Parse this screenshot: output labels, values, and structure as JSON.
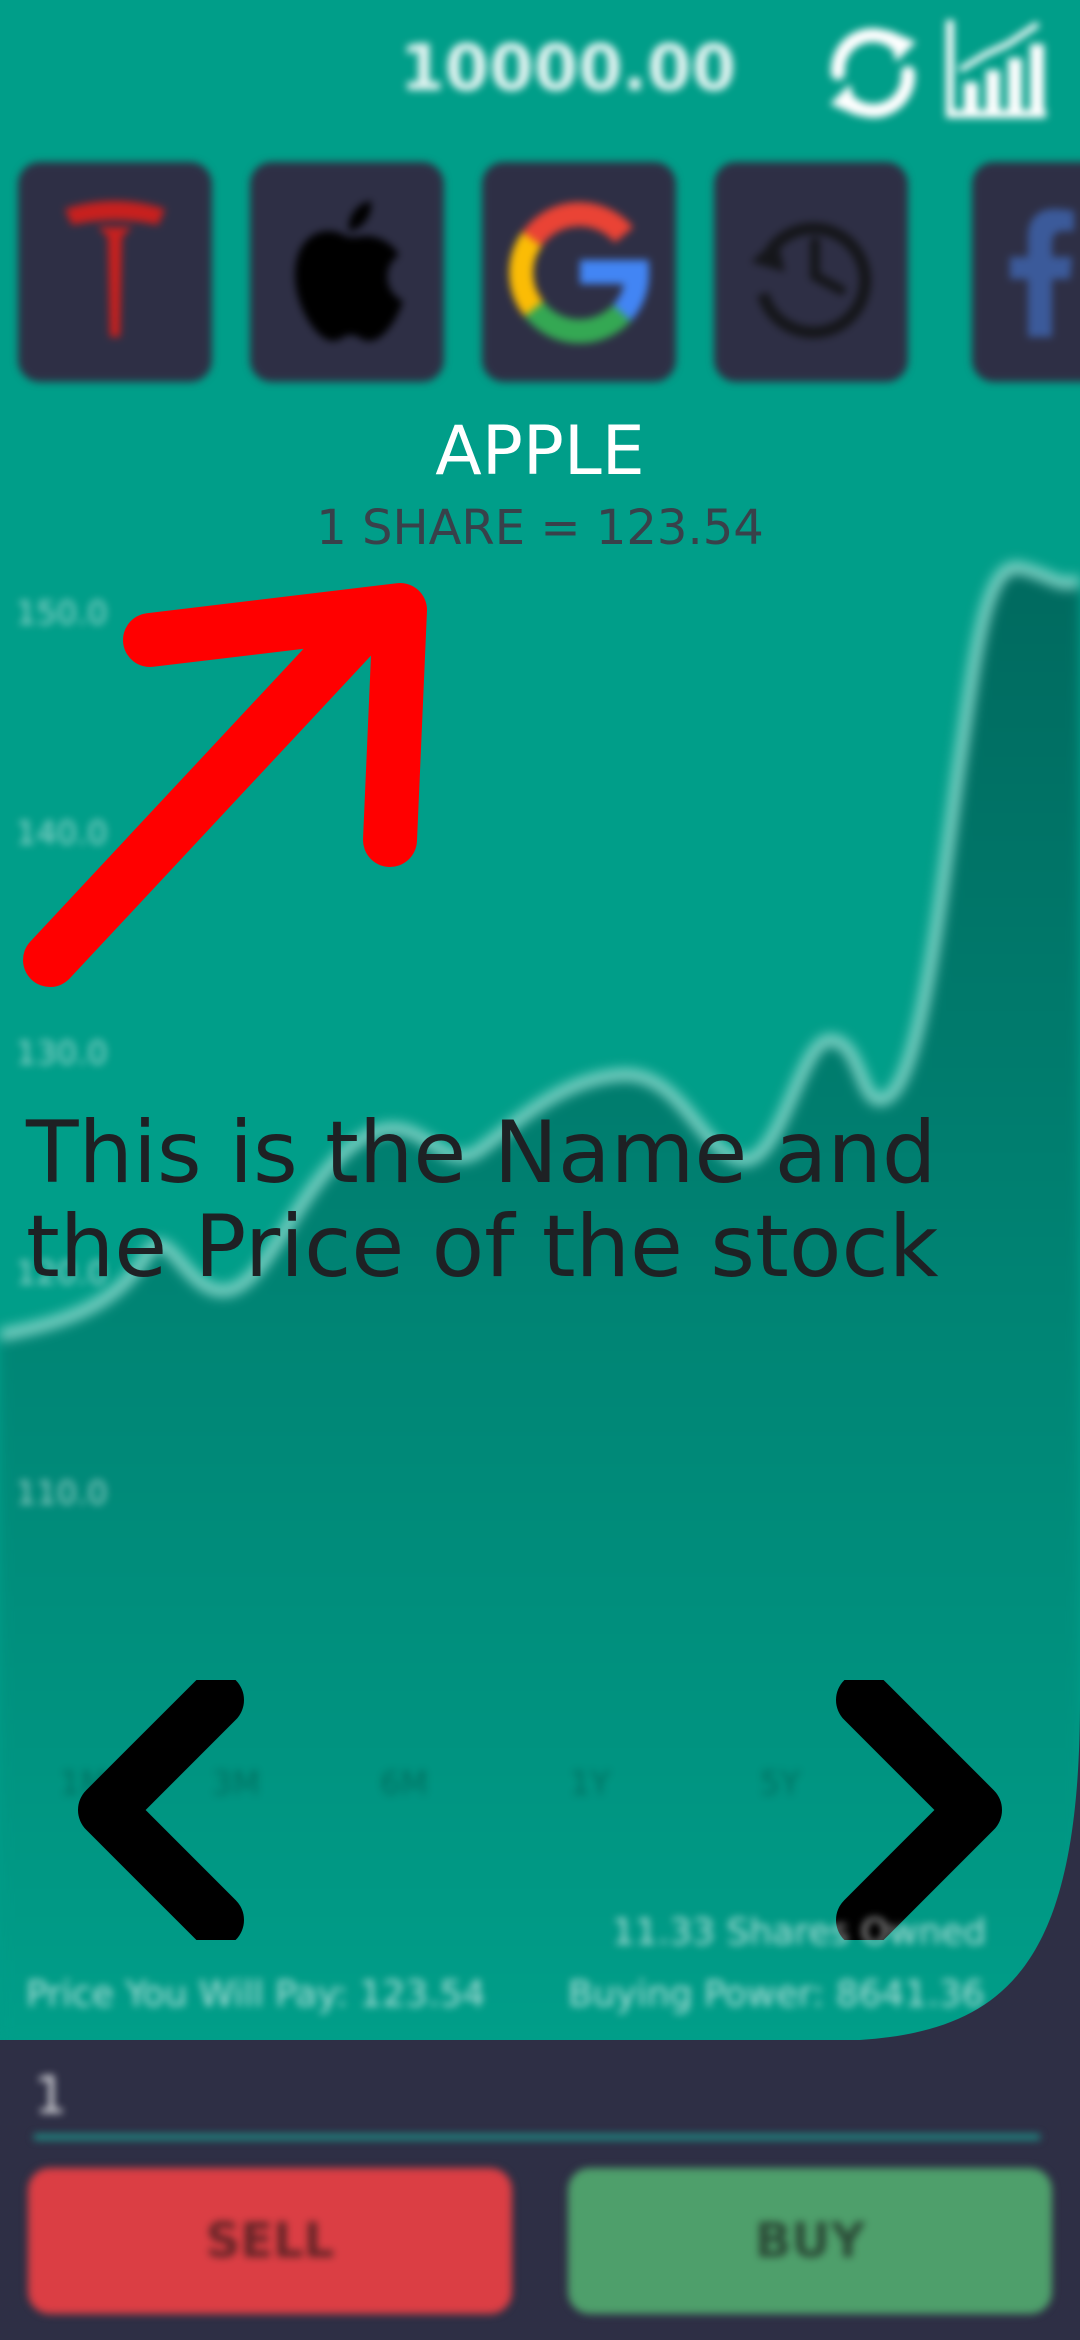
{
  "header": {
    "balance": "10000.00",
    "icons": [
      "refresh-icon",
      "stats-chart-icon"
    ]
  },
  "stocks": [
    {
      "name": "Tesla",
      "icon": "tesla-logo-icon"
    },
    {
      "name": "Apple",
      "icon": "apple-logo-icon"
    },
    {
      "name": "Google",
      "icon": "google-logo-icon"
    },
    {
      "name": "History",
      "icon": "history-icon"
    },
    {
      "name": "Facebook",
      "icon": "facebook-logo-icon"
    }
  ],
  "selected": {
    "name": "APPLE",
    "price_text": "1 SHARE = 123.54"
  },
  "chart": {
    "y_ticks": [
      "150.0",
      "140.0",
      "130.0",
      "120.0",
      "110.0"
    ],
    "x_ticks": [
      "1M",
      "3M",
      "6M",
      "1Y",
      "5Y"
    ]
  },
  "annotation": {
    "text": "This is the Name and the Price of the stock"
  },
  "stats": {
    "shares_owned": "11.33 Shares Owned",
    "price_you_will_pay": "Price You Will Pay: 123.54",
    "buying_power": "Buying Power: 8641.36"
  },
  "trade": {
    "quantity_value": "1",
    "sell_label": "SELL",
    "buy_label": "BUY"
  },
  "colors": {
    "background": "#009E89",
    "panel": "#2E2F45",
    "sell": "#DB3E44",
    "buy": "#4E9F6B",
    "annotation_arrow": "#FF0000"
  }
}
